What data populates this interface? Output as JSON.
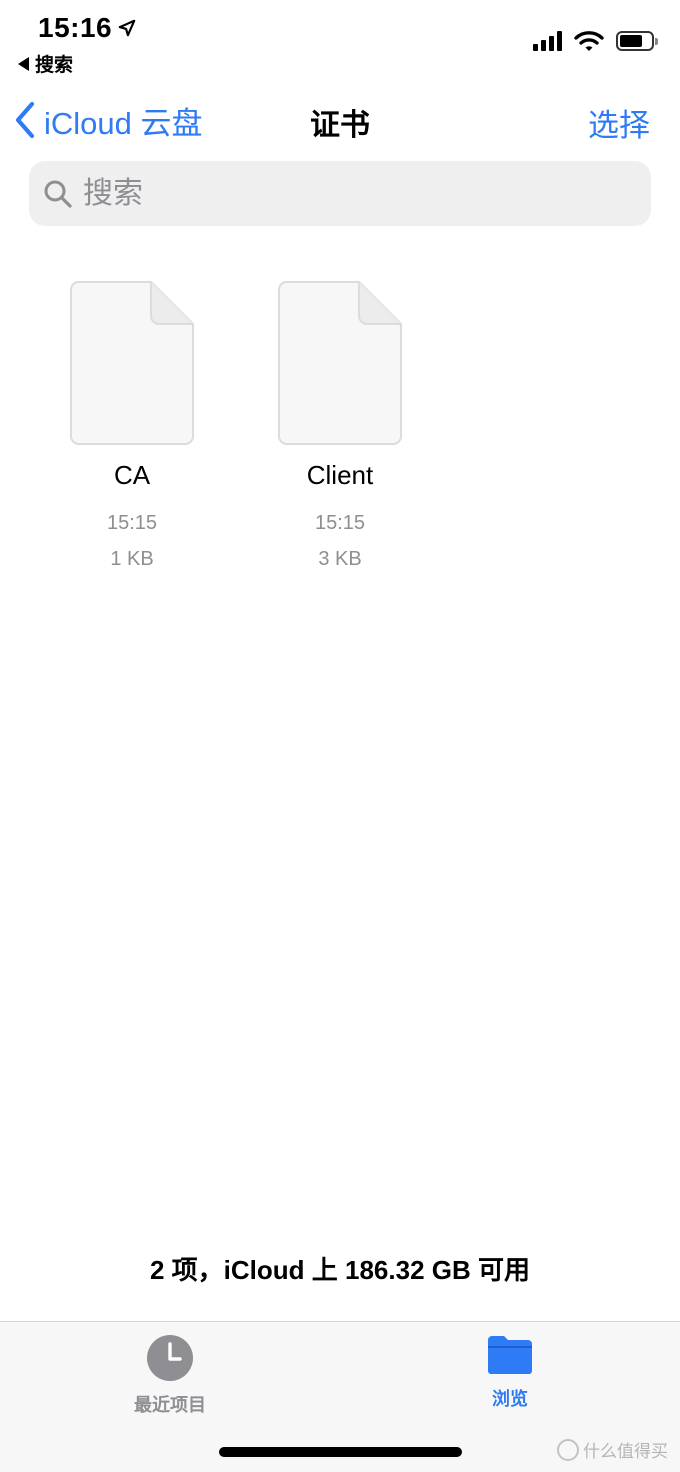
{
  "status_bar": {
    "time": "15:16",
    "back_app_label": "搜索"
  },
  "nav": {
    "back_label": "iCloud 云盘",
    "title": "证书",
    "select_label": "选择"
  },
  "search": {
    "placeholder": "搜索"
  },
  "files": [
    {
      "name": "CA",
      "time": "15:15",
      "size": "1 KB"
    },
    {
      "name": "Client",
      "time": "15:15",
      "size": "3 KB"
    }
  ],
  "storage_info": "2 项，iCloud 上 186.32 GB 可用",
  "tabbar": {
    "recent_label": "最近项目",
    "browse_label": "浏览"
  },
  "watermark": "什么值得买",
  "colors": {
    "accent": "#2f7bf5",
    "secondary_text": "#8e8e93",
    "search_bg": "#efeff0"
  }
}
